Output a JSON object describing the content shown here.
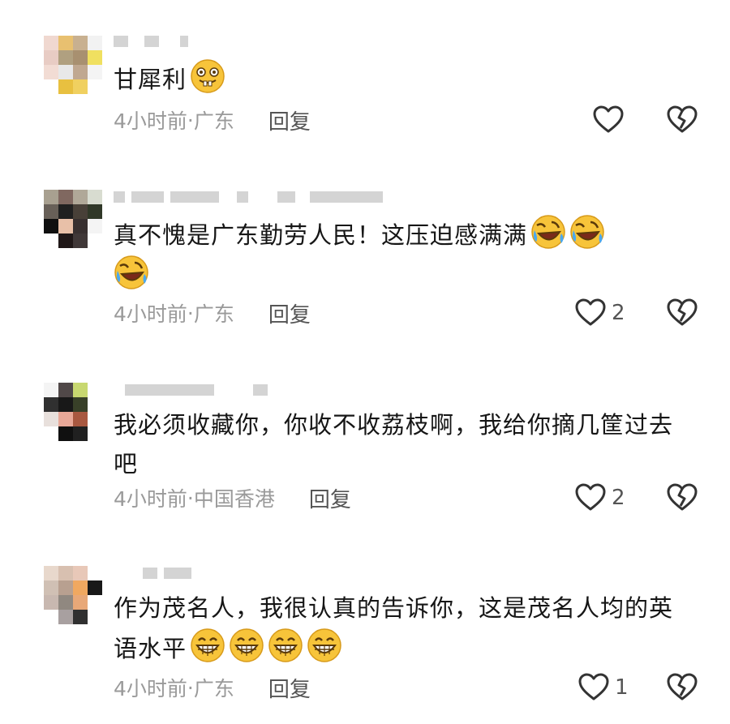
{
  "comments": [
    {
      "text": "甘犀利",
      "time": "4小时前",
      "location": "广东",
      "reply": "回复",
      "likes": "",
      "emojis": [
        "grin-teeth-icon"
      ]
    },
    {
      "text": "真不愧是广东勤劳人民！这压迫感满满",
      "time": "4小时前",
      "location": "广东",
      "reply": "回复",
      "likes": "2",
      "emojis": [
        "rofl-icon",
        "rofl-icon",
        "rofl-icon"
      ]
    },
    {
      "text": "我必须收藏你，你收不收荔枝啊，我给你摘几筐过去吧",
      "time": "4小时前",
      "location": "中国香港",
      "reply": "回复",
      "likes": "2",
      "emojis": []
    },
    {
      "text": "作为茂名人，我很认真的告诉你，这是茂名人均的英语水平",
      "time": "4小时前",
      "location": "广东",
      "reply": "回复",
      "likes": "1",
      "emojis": [
        "grin-icon",
        "grin-icon",
        "grin-icon",
        "grin-icon"
      ]
    }
  ],
  "separator": " · ",
  "colors": {
    "text": "#161616",
    "meta": "#9a9a9a",
    "emoji": "#f7c43a"
  }
}
